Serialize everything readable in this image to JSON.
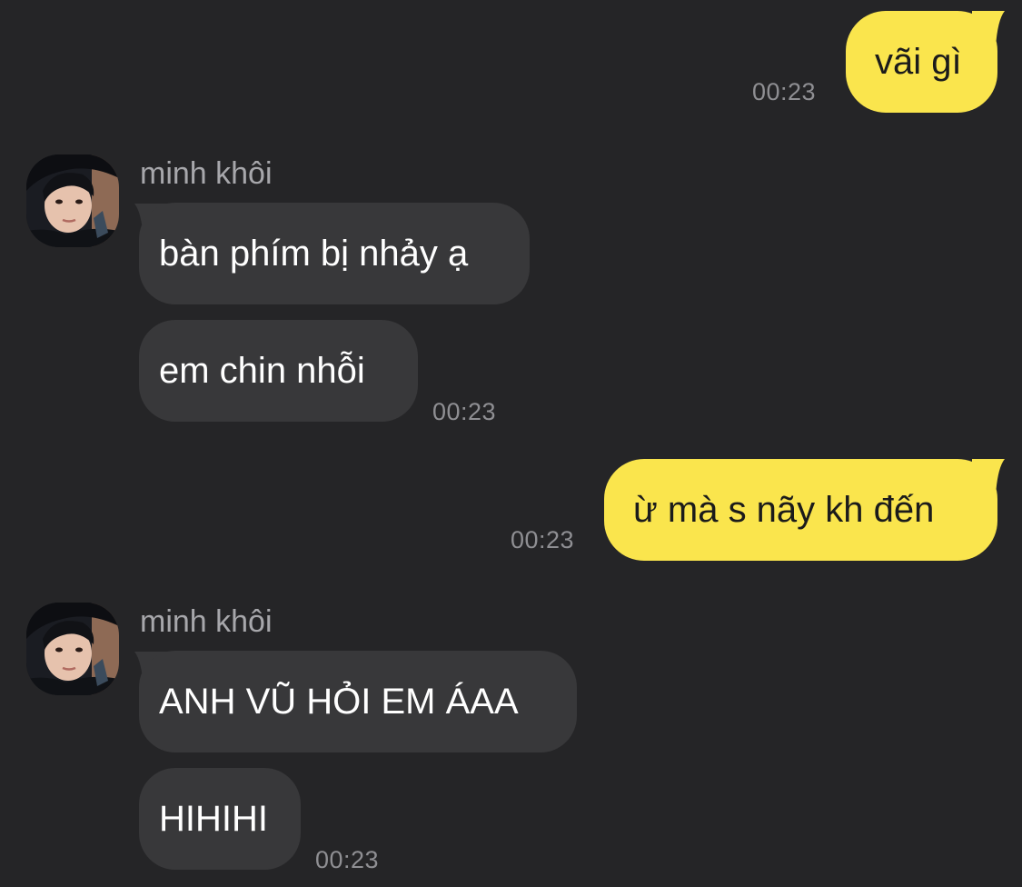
{
  "colors": {
    "background": "#252527",
    "outgoing_bubble": "#fae54d",
    "incoming_bubble": "#38383a",
    "timestamp": "#8f8f93",
    "sender_name": "#a7a7ab"
  },
  "messages": [
    {
      "direction": "outgoing",
      "text": "vãi gì",
      "time": "00:23"
    },
    {
      "direction": "incoming",
      "sender": "minh khôi",
      "avatar_icon": "user-avatar-icon",
      "bubbles": [
        "bàn phím bị nhảy ạ",
        "em chin nhỗi"
      ],
      "time": "00:23"
    },
    {
      "direction": "outgoing",
      "text": "ừ mà s nãy kh đến",
      "time": "00:23"
    },
    {
      "direction": "incoming",
      "sender": "minh khôi",
      "avatar_icon": "user-avatar-icon",
      "bubbles": [
        "ANH VŨ HỎI EM ÁAA",
        "HIHIHI"
      ],
      "time": "00:23"
    }
  ]
}
